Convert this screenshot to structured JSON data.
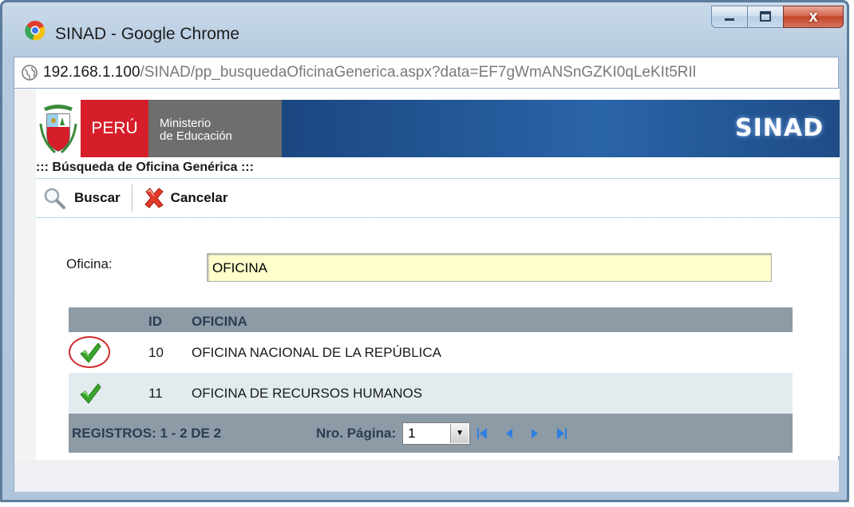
{
  "window": {
    "title": "SINAD - Google Chrome",
    "close_label": "x"
  },
  "address": {
    "host": "192.168.1.100",
    "path": "/SINAD/pp_busquedaOficinaGenerica.aspx?data=EF7gWmANSnGZKI0qLeKIt5RIl"
  },
  "banner": {
    "country": "PERÚ",
    "ministry_line1": "Ministerio",
    "ministry_line2": "de Educación",
    "system": "SINAD"
  },
  "page": {
    "title": "::: Búsqueda de Oficina Genérica :::"
  },
  "toolbar": {
    "search_label": "Buscar",
    "cancel_label": "Cancelar"
  },
  "form": {
    "office_label": "Oficina:",
    "office_value": "OFICINA"
  },
  "grid": {
    "columns": [
      "",
      "ID",
      "OFICINA"
    ],
    "rows": [
      {
        "id": "10",
        "name": "OFICINA NACIONAL DE LA REPÚBLICA",
        "selected": true
      },
      {
        "id": "11",
        "name": "OFICINA DE RECURSOS HUMANOS",
        "selected": false
      }
    ],
    "footer": {
      "records": "REGISTROS: 1 - 2 DE 2",
      "page_label": "Nro. Página:",
      "page_value": "1"
    }
  },
  "colors": {
    "accent_red": "#d61e2a",
    "banner_blue": "#1c4a85",
    "grid_header": "#8c9ba6",
    "input_bg": "#ffffcc",
    "check_green": "#3aa52b"
  }
}
